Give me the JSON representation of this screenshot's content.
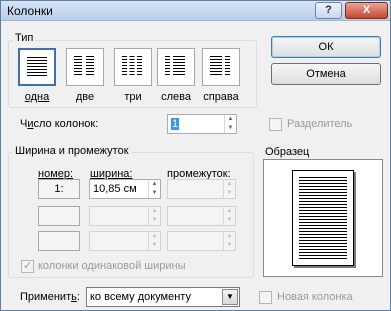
{
  "window": {
    "title": "Колонки",
    "help_glyph": "?",
    "close_glyph": "X"
  },
  "type_group": {
    "label": "Тип",
    "presets": [
      {
        "label": "одна",
        "selected": true
      },
      {
        "label": "две",
        "selected": false
      },
      {
        "label": "три",
        "selected": false
      },
      {
        "label": "слева",
        "selected": false
      },
      {
        "label": "справа",
        "selected": false
      }
    ]
  },
  "buttons": {
    "ok": "ОК",
    "cancel": "Отмена"
  },
  "columns_count": {
    "label_pre": "Ч",
    "label_ul": "и",
    "label_post": "сло колонок:",
    "value": "1"
  },
  "separator": {
    "label": "Разделитель",
    "checked": false,
    "enabled": false
  },
  "width_group": {
    "label": "Ширина и промежуток",
    "headers": {
      "number": "номер:",
      "width": "ширина:",
      "spacing": "промежуток:"
    },
    "rows": [
      {
        "number": "1:",
        "width": "10,85 см",
        "spacing": ""
      },
      {
        "number": "",
        "width": "",
        "spacing": ""
      },
      {
        "number": "",
        "width": "",
        "spacing": ""
      }
    ],
    "equal_width_label": "колонки одинаковой ширины",
    "equal_width_checked": true
  },
  "preview": {
    "label": "Образец"
  },
  "apply": {
    "label_pre": "Применит",
    "label_ul": "ь",
    "label_post": ":",
    "value": "ко всему документу"
  },
  "new_column": {
    "label": "Новая колонка",
    "checked": false,
    "enabled": false
  }
}
